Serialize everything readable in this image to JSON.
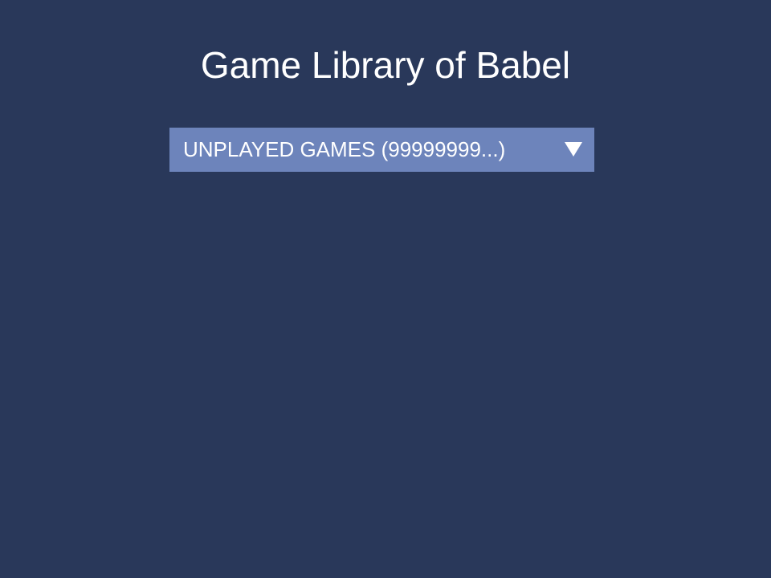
{
  "app": {
    "title": "Game Library of Babel"
  },
  "filter": {
    "selected_label": "UNPLAYED GAMES (99999999...)",
    "arrow_icon": "chevron-down-icon"
  },
  "colors": {
    "background": "#29385a",
    "dropdown": "#6d84bb",
    "text": "#ffffff"
  }
}
